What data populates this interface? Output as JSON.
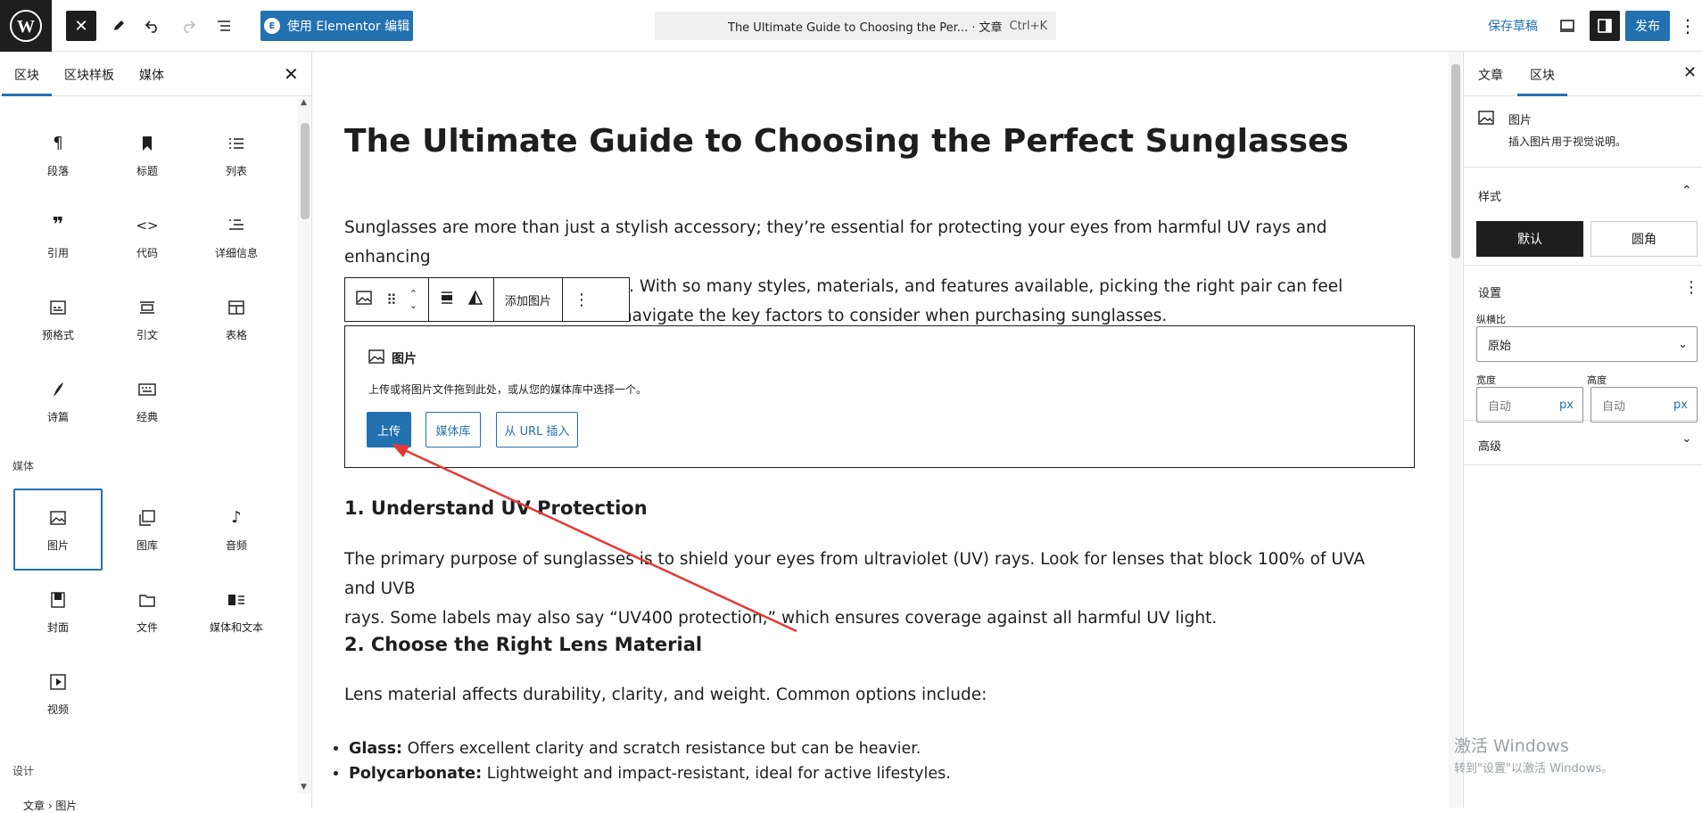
{
  "topbar": {
    "elementor_label": "使用 Elementor 编辑",
    "command_text": "The Ultimate Guide to Choosing the Per... · 文章",
    "command_shortcut": "Ctrl+K",
    "save_draft": "保存草稿",
    "publish": "发布"
  },
  "left": {
    "tabs": [
      "区块",
      "区块样板",
      "媒体"
    ],
    "text_blocks": [
      "段落",
      "标题",
      "列表",
      "引用",
      "代码",
      "详细信息",
      "预格式",
      "引文",
      "表格",
      "诗篇",
      "经典"
    ],
    "media_heading": "媒体",
    "media_blocks": [
      "图片",
      "图库",
      "音频",
      "封面",
      "文件",
      "媒体和文本",
      "视频"
    ],
    "design_heading": "设计",
    "breadcrumb": "文章 › 图片"
  },
  "content": {
    "title": "The Ultimate Guide to Choosing the Perfect Sunglasses",
    "intro_line1": "Sunglasses are more than just a stylish accessory; they’re essential for protecting your eyes from harmful UV rays and enhancing",
    "intro_line2": "your overall comfort in bright light. With so many styles, materials, and features available, picking the right pair can feel",
    "intro_line3": "ou navigate the key factors to consider when purchasing sunglasses.",
    "toolbar_add_image": "添加图片",
    "placeholder_title": "图片",
    "placeholder_desc": "上传或将图片文件拖到此处，或从您的媒体库中选择一个。",
    "btn_upload": "上传",
    "btn_library": "媒体库",
    "btn_url": "从 URL 插入",
    "h1": "1. Understand UV Protection",
    "p1_line1": "The primary purpose of sunglasses is to shield your eyes from ultraviolet (UV) rays. Look for lenses that block 100% of UVA and UVB",
    "p1_line2": "rays. Some labels may also say “UV400 protection,” which ensures coverage against all harmful UV light.",
    "h2": "2. Choose the Right Lens Material",
    "p2": "Lens material affects durability, clarity, and weight. Common options include:",
    "list": [
      {
        "term": "Glass:",
        "text": " Offers excellent clarity and scratch resistance but can be heavier."
      },
      {
        "term": "Polycarbonate:",
        "text": " Lightweight and impact-resistant, ideal for active lifestyles."
      }
    ]
  },
  "right": {
    "tabs": [
      "文章",
      "区块"
    ],
    "block_name": "图片",
    "block_desc": "插入图片用于视觉说明。",
    "styles_heading": "样式",
    "style_default": "默认",
    "style_rounded": "圆角",
    "settings_heading": "设置",
    "aspect_label": "纵横比",
    "aspect_value": "原始",
    "width_label": "宽度",
    "height_label": "高度",
    "auto": "自动",
    "unit": "px",
    "advanced_heading": "高级"
  },
  "watermark": {
    "line1": "激活 Windows",
    "line2": "转到\"设置\"以激活 Windows。"
  },
  "colors": {
    "accent": "#2271b1",
    "dark": "#1e1e1e",
    "annotation": "#e53935"
  }
}
